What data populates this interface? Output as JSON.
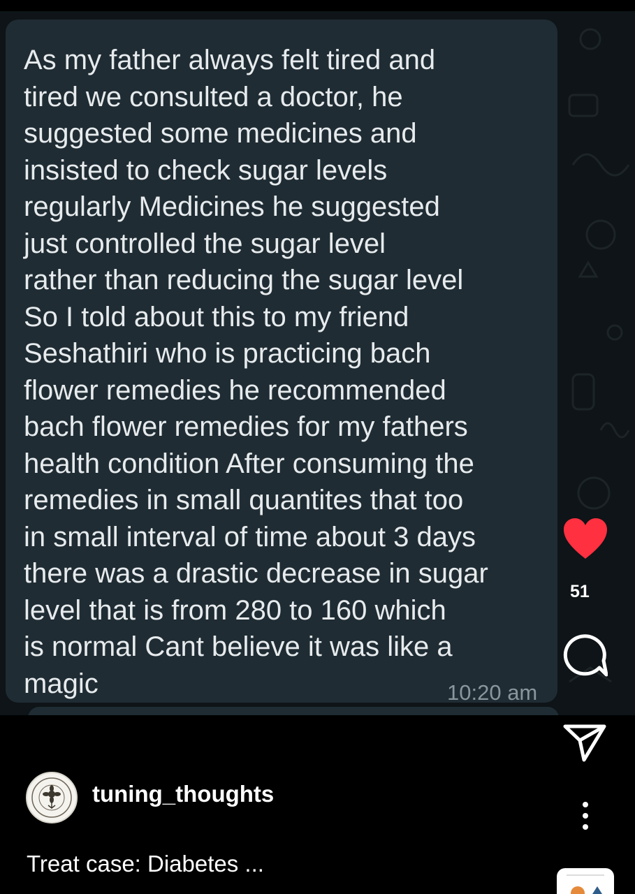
{
  "post": {
    "message_lines": [
      "As my father always felt tired and",
      "tired we consulted a doctor, he",
      "suggested some medicines and",
      "insisted to check sugar levels",
      "regularly Medicines he suggested",
      "just controlled the sugar level",
      "rather than reducing the sugar level",
      "So I told about this to my friend",
      "Seshathiri who is practicing bach",
      "flower remedies he recommended",
      "bach flower remedies for my fathers",
      "health condition After consuming the",
      "remedies in small quantites that too",
      "in small interval of time about 3 days",
      "there was a drastic decrease in sugar",
      "level that is from 280 to 160 which",
      "is normal Cant believe it was like a",
      "magic"
    ],
    "message_time": "10:20 am"
  },
  "actions": {
    "like_count": "51",
    "like_icon": "heart-icon",
    "comment_icon": "comment-icon",
    "share_icon": "send-icon",
    "more_icon": "more-vertical-icon",
    "like_color": "#ff3040"
  },
  "author": {
    "username": "tuning_thoughts"
  },
  "caption": "Treat case: Diabetes ..."
}
